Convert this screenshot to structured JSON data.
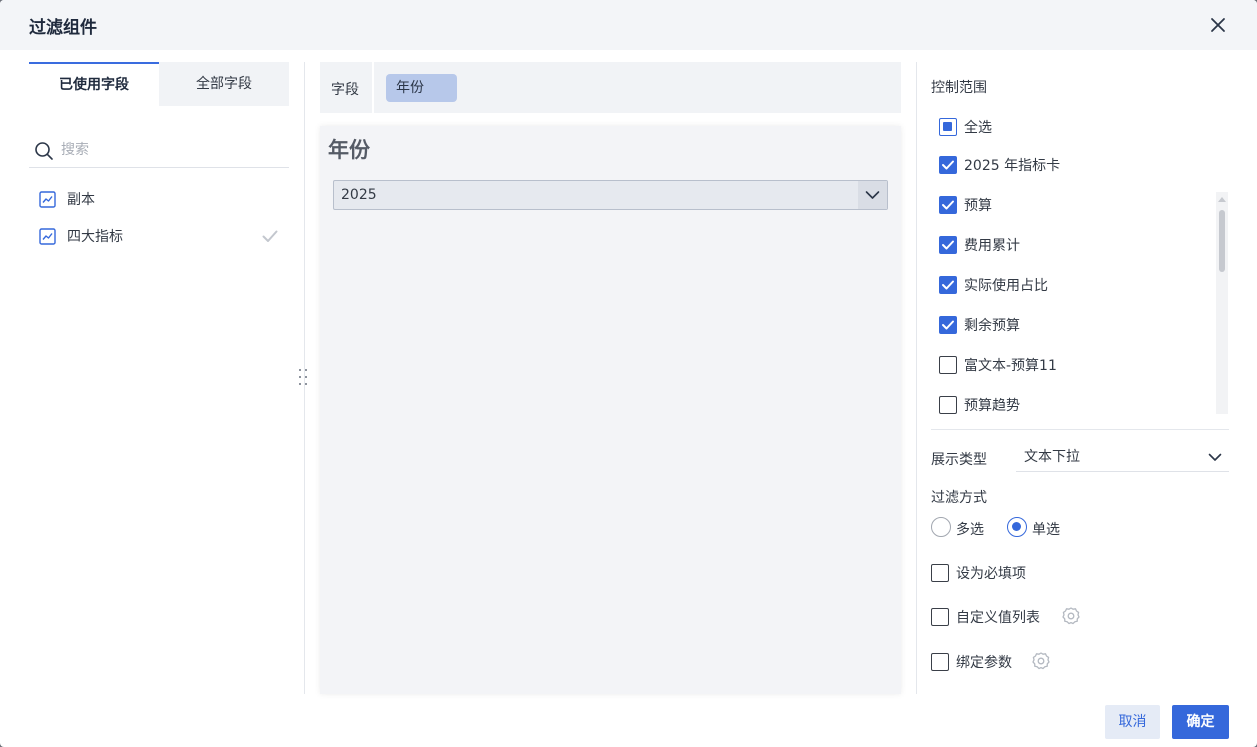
{
  "dialog": {
    "title": "过滤组件"
  },
  "left": {
    "tabs": [
      {
        "label": "已使用字段"
      },
      {
        "label": "全部字段"
      }
    ],
    "search_placeholder": "搜索",
    "fields": [
      {
        "label": "副本",
        "checked": false
      },
      {
        "label": "四大指标",
        "checked": true
      }
    ]
  },
  "middle": {
    "field_label": "字段",
    "chip_label": "年份",
    "preview_title": "年份",
    "select_value": "2025"
  },
  "right": {
    "scope_label": "控制范围",
    "scope_items": [
      {
        "label": "全选",
        "state": "partial"
      },
      {
        "label": "2025 年指标卡",
        "state": "checked"
      },
      {
        "label": "预算",
        "state": "checked"
      },
      {
        "label": "费用累计",
        "state": "checked"
      },
      {
        "label": "实际使用占比",
        "state": "checked"
      },
      {
        "label": "剩余预算",
        "state": "checked"
      },
      {
        "label": "富文本-预算11",
        "state": "unchecked"
      },
      {
        "label": "预算趋势",
        "state": "unchecked"
      }
    ],
    "display_type_label": "展示类型",
    "display_type_value": "文本下拉",
    "filter_mode_label": "过滤方式",
    "filter_modes": [
      {
        "label": "多选",
        "selected": false
      },
      {
        "label": "单选",
        "selected": true
      }
    ],
    "options": [
      {
        "label": "设为必填项",
        "checked": false,
        "gear": false
      },
      {
        "label": "自定义值列表",
        "checked": false,
        "gear": true
      },
      {
        "label": "绑定参数",
        "checked": false,
        "gear": true
      }
    ]
  },
  "footer": {
    "cancel_label": "取消",
    "ok_label": "确定"
  },
  "colors": {
    "primary": "#3568db",
    "chip": "#b7c8ea",
    "panel": "#f1f3f6"
  }
}
